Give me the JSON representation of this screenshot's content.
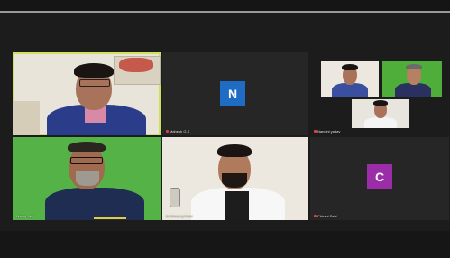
{
  "participants": [
    {
      "name": "",
      "avatar_letter": ""
    },
    {
      "name": "Mahesh G.S",
      "avatar_letter": "N",
      "avatar_color": "#1f6cc4"
    },
    {
      "name": "Nandini yadav",
      "avatar_letter": ""
    },
    {
      "name": "Manoj Jain",
      "avatar_letter": ""
    },
    {
      "name": "Dr Dhanraj Patel",
      "avatar_letter": ""
    },
    {
      "name": "Chhavi Sehi",
      "avatar_letter": "C",
      "avatar_color": "#9b2ea8"
    }
  ],
  "colors": {
    "active_speaker_border": "#cfe05a",
    "background": "#1c1c1c"
  }
}
